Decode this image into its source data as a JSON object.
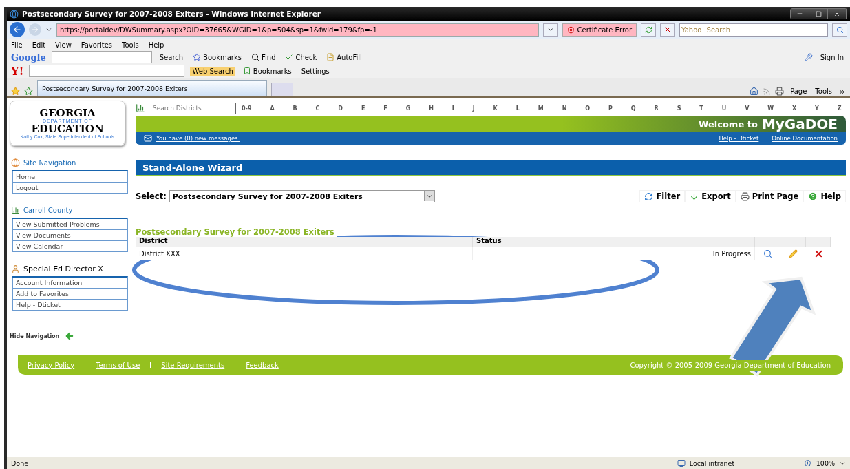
{
  "browser": {
    "title": "Postsecondary Survey for 2007-2008 Exiters - Windows Internet Explorer",
    "address": "https://portaldev/DWSummary.aspx?OID=37665&WGID=1&p=504&sp=1&fwid=179&fp=-1",
    "certificate": "Certificate Error",
    "search_placeholder": "Yahoo! Search",
    "menu": [
      "File",
      "Edit",
      "View",
      "Favorites",
      "Tools",
      "Help"
    ],
    "google_toolbar": {
      "logo": "Google",
      "search": "Search",
      "bookmarks": "Bookmarks",
      "find": "Find",
      "check": "Check",
      "autofill": "AutoFill",
      "sign_in": "Sign In"
    },
    "yahoo_toolbar": {
      "logo": "Y!",
      "web_search": "Web Search",
      "bookmarks": "Bookmarks",
      "settings": "Settings"
    },
    "tab": {
      "title": "Postsecondary Survey for 2007-2008 Exiters"
    },
    "command_bar": [
      "Page",
      "Tools"
    ],
    "status_bar": {
      "text": "Done",
      "zone": "Local intranet",
      "zoom": "100%"
    }
  },
  "site": {
    "logo": {
      "name": "GEORGIA",
      "department": "DEPARTMENT OF",
      "education": "EDUCATION",
      "tagline": "Kathy Cox, State Superintendent of Schools"
    },
    "search_placeholder": "Search Districts",
    "alphabet": [
      "0-9",
      "A",
      "B",
      "C",
      "D",
      "E",
      "F",
      "G",
      "H",
      "I",
      "J",
      "K",
      "L",
      "M",
      "N",
      "O",
      "P",
      "Q",
      "R",
      "S",
      "T",
      "U",
      "V",
      "W",
      "X",
      "Y",
      "Z"
    ],
    "welcome": "Welcome to",
    "brand": "MyGaDOE",
    "messages": "You have (0) new messages.",
    "header_links": [
      "Help - Dticket",
      "Online Documentation"
    ],
    "nav": [
      {
        "kind": "site",
        "title": "Site Navigation",
        "items": [
          "Home",
          "Logout"
        ]
      },
      {
        "kind": "district",
        "title": "Carroll County",
        "items": [
          "View Submitted Problems",
          "View Documents",
          "View Calendar"
        ]
      },
      {
        "kind": "user",
        "title": "Special Ed Director X",
        "items": [
          "Account Information",
          "Add to Favorites",
          "Help - Dticket"
        ]
      }
    ],
    "hide_navigation": "Hide Navigation",
    "page_title": "Stand-Alone Wizard",
    "select": {
      "label": "Select:",
      "value": "Postsecondary Survey for 2007-2008 Exiters"
    },
    "actions": [
      {
        "kind": "filter",
        "label": "Filter"
      },
      {
        "kind": "export",
        "label": "Export"
      },
      {
        "kind": "print",
        "label": "Print Page"
      },
      {
        "kind": "help",
        "label": "Help"
      }
    ],
    "section_title": "Postsecondary Survey for 2007-2008 Exiters",
    "table": {
      "columns": [
        "District",
        "Status"
      ],
      "rows": [
        {
          "district": "District XXX",
          "status": "In Progress"
        }
      ]
    },
    "footer_links": [
      "Privacy Policy",
      "Terms of Use",
      "Site Requirements",
      "Feedback"
    ],
    "copyright": "Copyright © 2005-2009 Georgia Department of Education"
  }
}
